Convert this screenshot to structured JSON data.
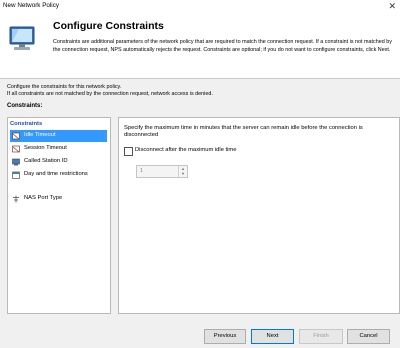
{
  "window": {
    "title": "New Network Policy",
    "close": "✕"
  },
  "header": {
    "title": "Configure Constraints",
    "description": "Constraints are additional parameters of the network policy that are required to match the connection request. If a constraint is not matched by the connection request, NPS automatically rejects the request. Constraints are optional; if you do not want to configure constraints, click Next."
  },
  "intro": {
    "line1": "Configure the constraints for this network policy.",
    "line2": "If all constraints are not matched by the connection request, network access is denied."
  },
  "constraints_label": "Constraints:",
  "constraints_panel": {
    "header": "Constraints",
    "items": [
      {
        "label": "Idle Timeout",
        "icon": "idle-timeout-icon",
        "selected": true
      },
      {
        "label": "Session Timeout",
        "icon": "session-timeout-icon"
      },
      {
        "label": "Called Station ID",
        "icon": "called-station-icon"
      },
      {
        "label": "Day and time restrictions",
        "icon": "calendar-icon"
      },
      {
        "label": "NAS Port Type",
        "icon": "nas-port-icon"
      }
    ]
  },
  "detail": {
    "description": "Specify the maximum time in minutes that the server can remain idle before the connection is disconnected",
    "checkbox_label": "Disconnect after the maximum idle time",
    "checkbox_checked": false,
    "spinner_value": "1"
  },
  "buttons": {
    "previous": "Previous",
    "next": "Next",
    "finish": "Finish",
    "cancel": "Cancel"
  }
}
